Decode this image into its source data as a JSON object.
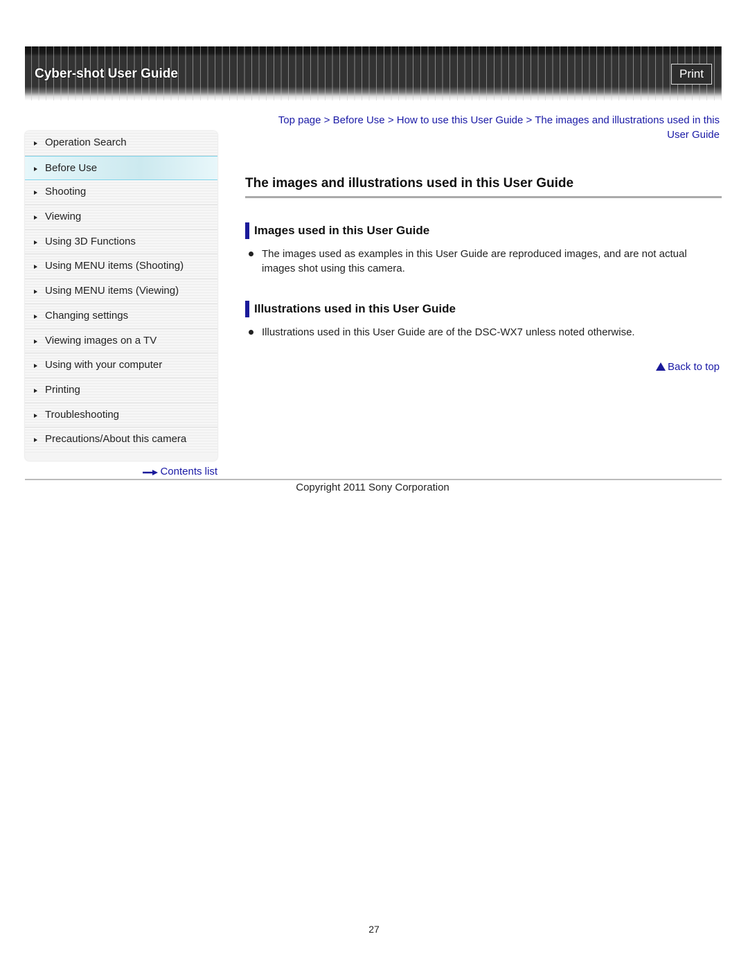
{
  "header": {
    "title": "Cyber-shot User Guide",
    "print_label": "Print"
  },
  "breadcrumb": {
    "items": [
      "Top page",
      "Before Use",
      "How to use this User Guide",
      "The images and illustrations used in this User Guide"
    ],
    "separator": ">"
  },
  "sidebar": {
    "items": [
      {
        "label": "Operation Search",
        "active": false
      },
      {
        "label": "Before Use",
        "active": true
      },
      {
        "label": "Shooting",
        "active": false
      },
      {
        "label": "Viewing",
        "active": false
      },
      {
        "label": "Using 3D Functions",
        "active": false
      },
      {
        "label": "Using MENU items (Shooting)",
        "active": false
      },
      {
        "label": "Using MENU items (Viewing)",
        "active": false
      },
      {
        "label": "Changing settings",
        "active": false
      },
      {
        "label": "Viewing images on a TV",
        "active": false
      },
      {
        "label": "Using with your computer",
        "active": false
      },
      {
        "label": "Printing",
        "active": false
      },
      {
        "label": "Troubleshooting",
        "active": false
      },
      {
        "label": "Precautions/About this camera",
        "active": false
      }
    ],
    "contents_link": "Contents list"
  },
  "main": {
    "title": "The images and illustrations used in this User Guide",
    "sections": [
      {
        "heading": "Images used in this User Guide",
        "bullets": [
          "The images used as examples in this User Guide are reproduced images, and are not actual images shot using this camera."
        ]
      },
      {
        "heading": "Illustrations used in this User Guide",
        "bullets": [
          "Illustrations used in this User Guide are of the DSC-WX7 unless noted otherwise."
        ]
      }
    ],
    "back_to_top": "Back to top"
  },
  "footer": {
    "copyright": "Copyright 2011 Sony Corporation",
    "page_number": "27"
  },
  "colors": {
    "link": "#1a1aa6",
    "accent_bar": "#1a1a9a",
    "active_item": "#cce9ef"
  }
}
